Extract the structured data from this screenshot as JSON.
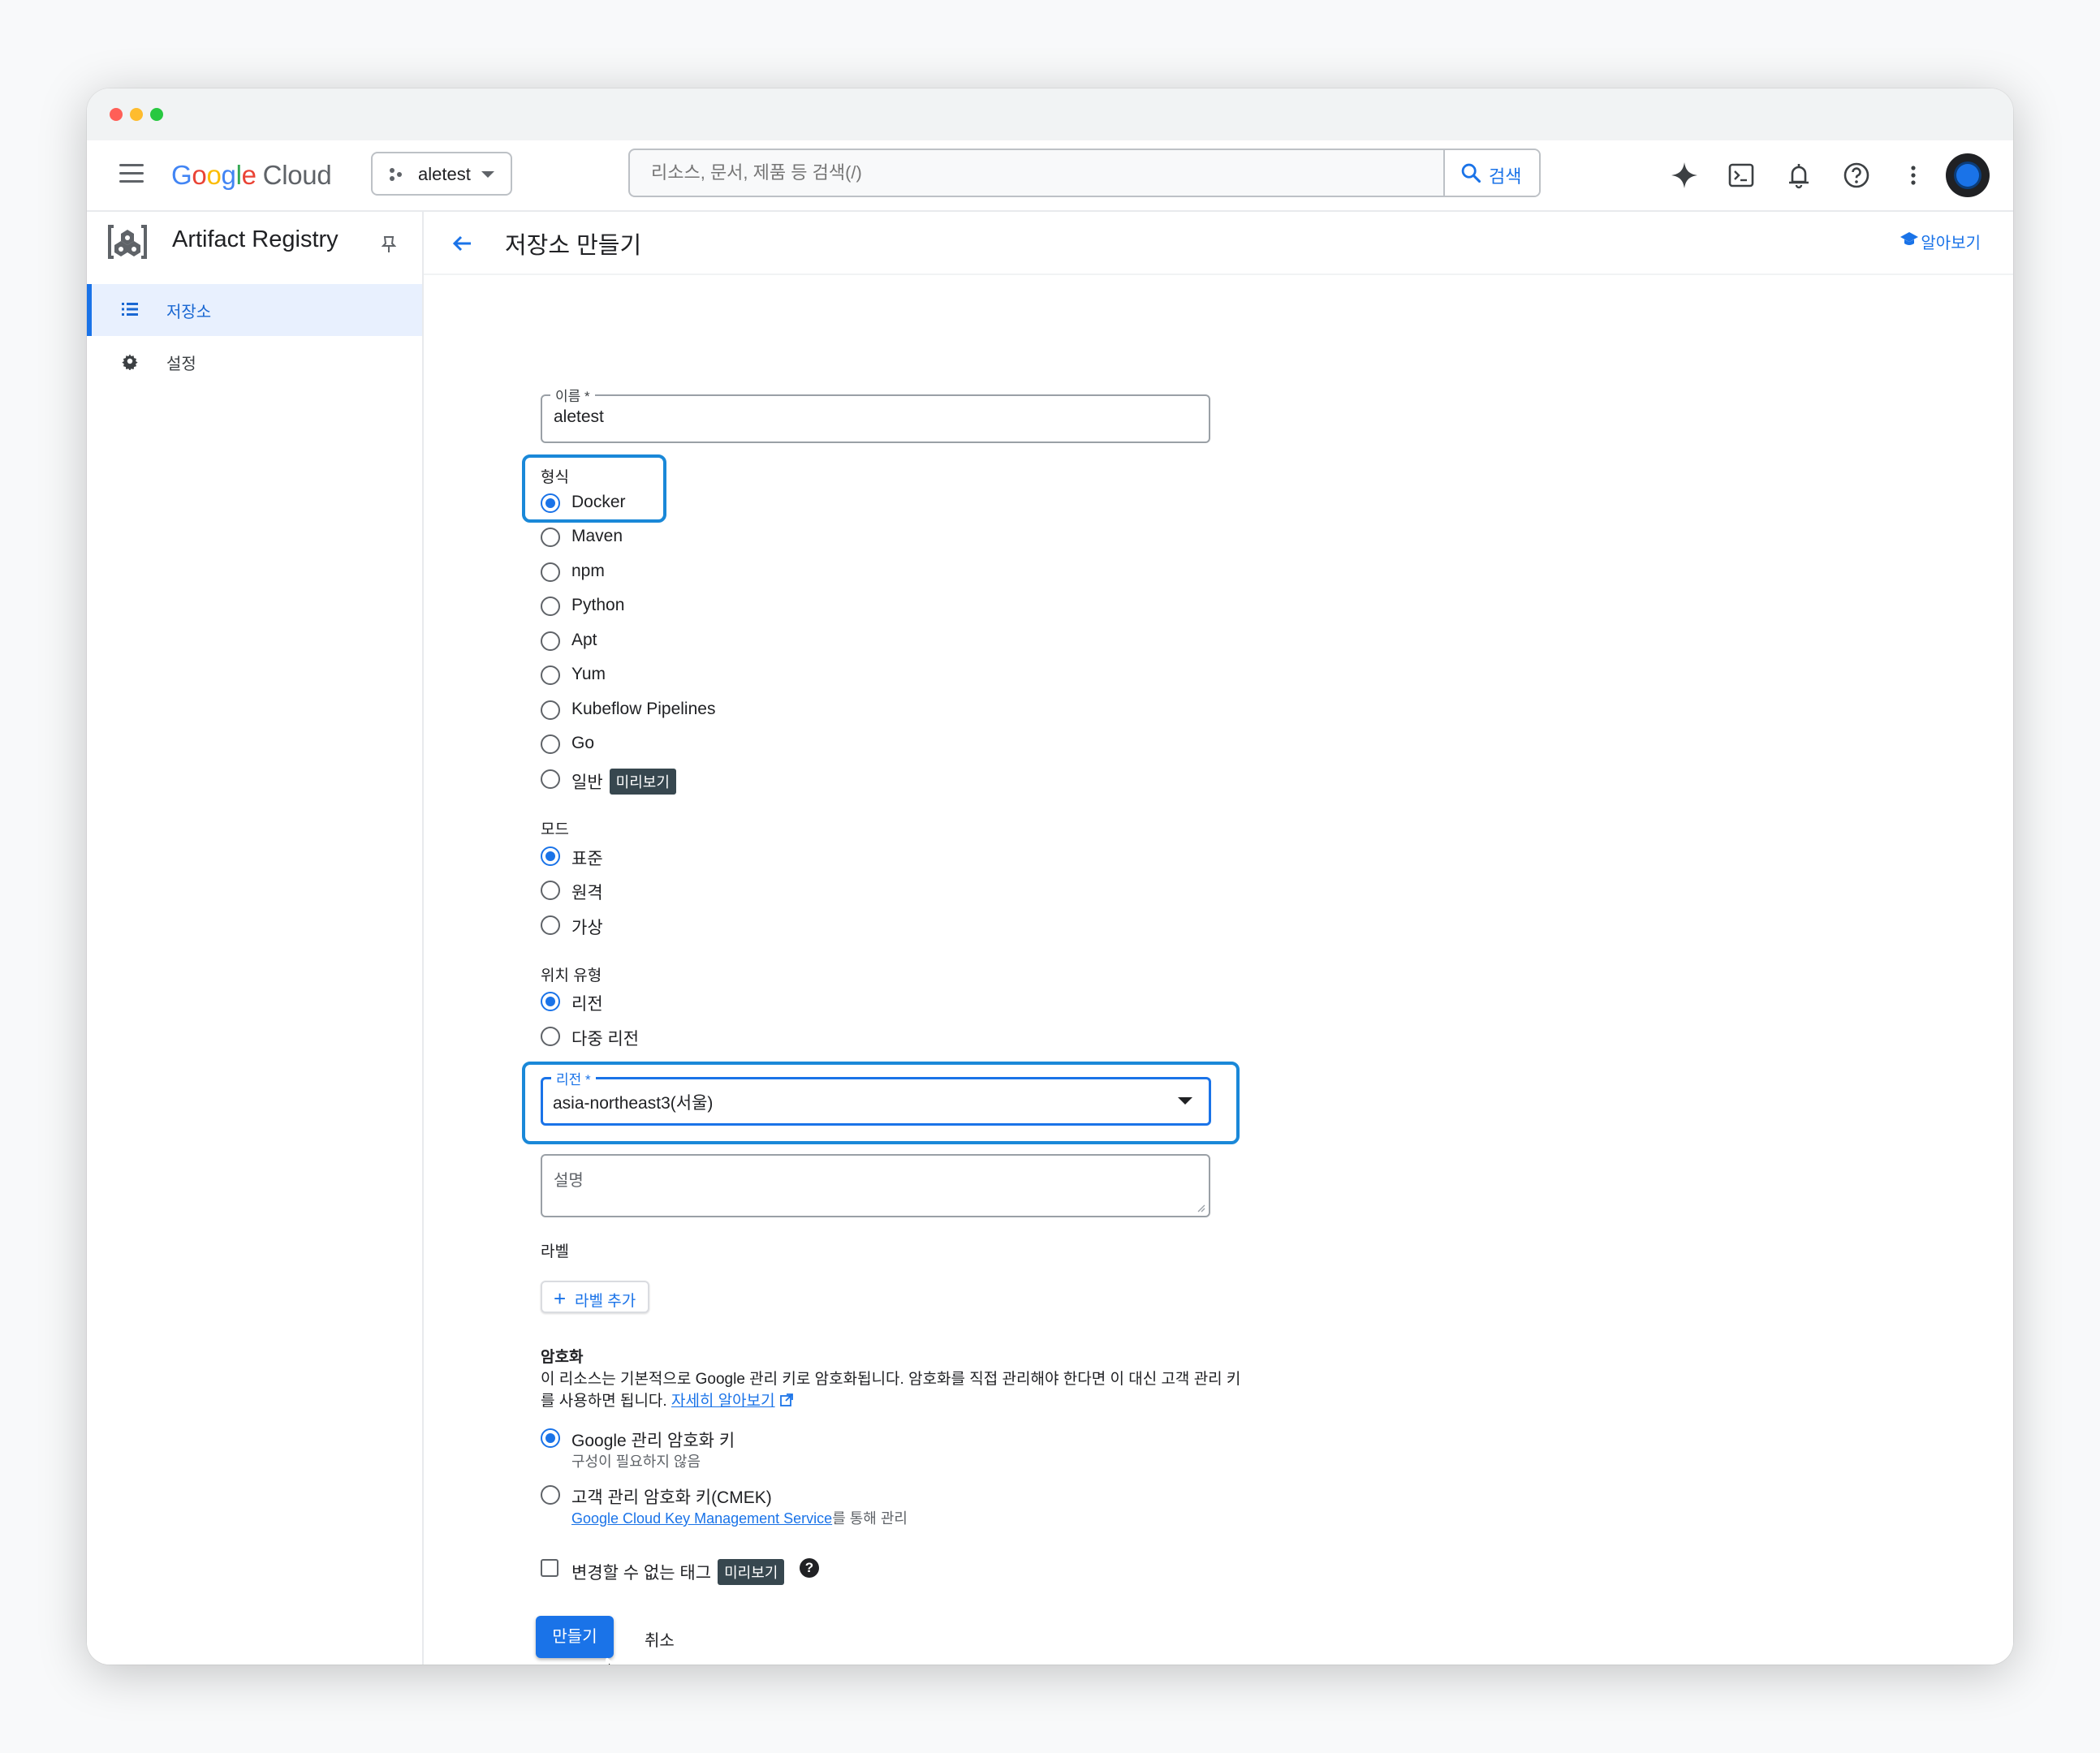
{
  "app": {
    "logo": {
      "g1": "G",
      "o1": "o",
      "o2": "o",
      "g2": "g",
      "l": "l",
      "e": "e",
      "cloud": "Cloud"
    },
    "project": "aletest",
    "search_placeholder": "리소스, 문서, 제품 등 검색(/)",
    "search_button": "검색"
  },
  "sidebar": {
    "product_name": "Artifact Registry",
    "items": [
      {
        "label": "저장소",
        "active": true
      },
      {
        "label": "설정",
        "active": false
      }
    ]
  },
  "page": {
    "title": "저장소 만들기",
    "learn_label": "알아보기"
  },
  "form": {
    "name": {
      "label": "이름 *",
      "value": "aletest"
    },
    "format": {
      "label": "형식",
      "options": [
        "Docker",
        "Maven",
        "npm",
        "Python",
        "Apt",
        "Yum",
        "Kubeflow Pipelines",
        "Go",
        "일반"
      ],
      "selected": "Docker",
      "preview_badge": "미리보기"
    },
    "mode": {
      "label": "모드",
      "options": [
        "표준",
        "원격",
        "가상"
      ],
      "selected": "표준"
    },
    "location_type": {
      "label": "위치 유형",
      "options": [
        "리전",
        "다중 리전"
      ],
      "selected": "리전"
    },
    "region": {
      "label": "리전 *",
      "value": "asia-northeast3(서울)"
    },
    "description": {
      "placeholder": "설명"
    },
    "labels": {
      "label": "라벨",
      "add_button": "라벨 추가"
    },
    "encryption": {
      "label": "암호화",
      "desc_line1": "이 리소스는 기본적으로 Google 관리 키로 암호화됩니다. 암호화를 직접 관리해야 한다면 이 대신 고객 관리 키",
      "desc_line2": "를 사용하면 됩니다.",
      "learn_more": "자세히 알아보기",
      "options": [
        {
          "label": "Google 관리 암호화 키",
          "sub": "구성이 필요하지 않음"
        },
        {
          "label": "고객 관리 암호화 키(CMEK)",
          "sub_link": "Google Cloud Key Management Service",
          "sub_suffix": "를 통해 관리"
        }
      ],
      "selected": "Google 관리 암호화 키"
    },
    "immutable_tags": {
      "label": "변경할 수 없는 태그",
      "badge": "미리보기",
      "help": "?"
    },
    "create_button": "만들기",
    "cancel_button": "취소"
  },
  "colors": {
    "accent": "#1a73e8",
    "highlight": "#1a88d8"
  }
}
